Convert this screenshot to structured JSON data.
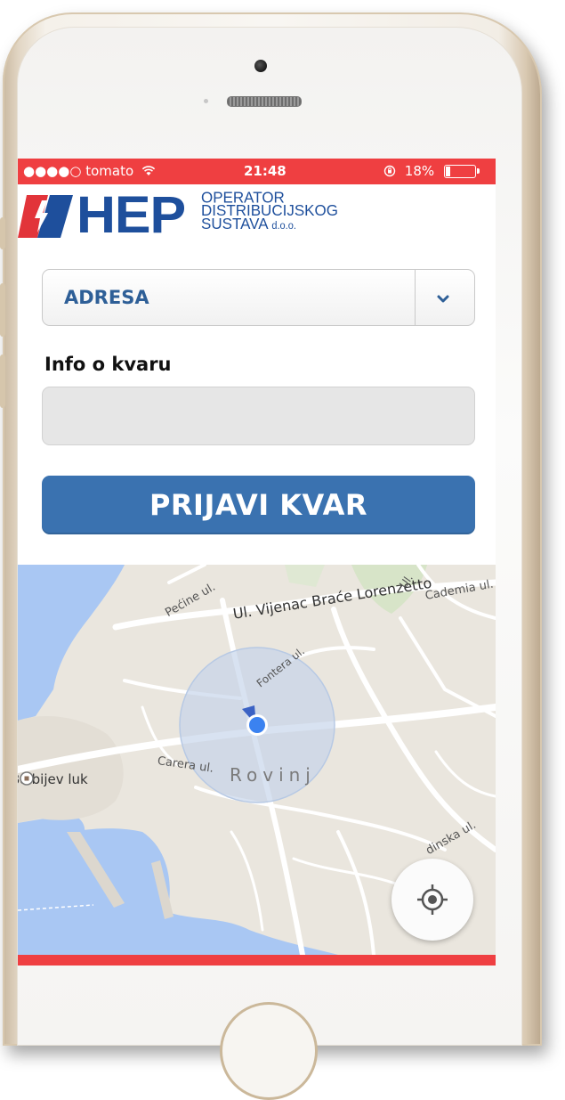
{
  "status_bar": {
    "carrier": "●●●●○ tomato",
    "time": "21:48",
    "battery": "18%"
  },
  "logo": {
    "letters": "HEP",
    "line1": "OPERATOR",
    "line2": "DISTRIBUCIJSKOG",
    "line3": "SUSTAVA",
    "suffix": "d.o.o."
  },
  "form": {
    "address_value": "ADRESA",
    "info_label": "Info o kvaru",
    "info_value": "",
    "submit_label": "PRIJAVI KVAR"
  },
  "map": {
    "streets": {
      "pecine": "Pećine ul.",
      "vijenac": "Ul. Vijenac Braće Lorenzetto",
      "fontera": "Fontera ul.",
      "carera": "Carera ul.",
      "cademia": "Cademia ul.",
      "ul": "Ul.",
      "dinska": "dinska ul."
    },
    "poi": "Balbijev luk",
    "city": "Rovinj"
  },
  "colors": {
    "brand_red": "#ef3f41",
    "brand_blue": "#1e4f9c",
    "button_blue": "#3a72b0",
    "water": "#a9c7f3",
    "location_dot": "#3b82f0"
  },
  "icons": {
    "status_wifi": "wifi-icon",
    "status_rotation_lock": "rotation-lock-icon",
    "battery": "battery-icon",
    "dropdown": "chevron-down-icon",
    "locate": "my-location-icon",
    "poi": "poi-marker-icon"
  }
}
